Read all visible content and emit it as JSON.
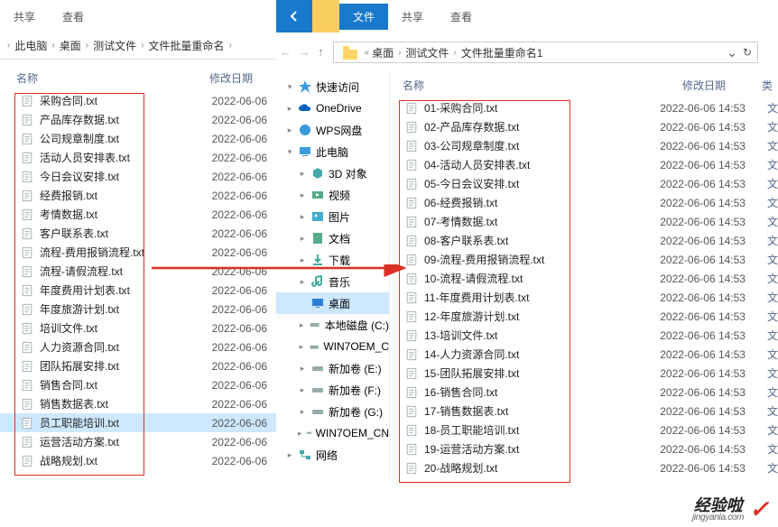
{
  "left": {
    "tabs": {
      "share": "共享",
      "view": "查看"
    },
    "breadcrumb": [
      "此电脑",
      "桌面",
      "测试文件",
      "文件批量重命名"
    ],
    "cols": {
      "name": "名称",
      "date": "修改日期"
    },
    "files": [
      {
        "name": "采购合同.txt",
        "date": "2022-06-06"
      },
      {
        "name": "产品库存数据.txt",
        "date": "2022-06-06"
      },
      {
        "name": "公司规章制度.txt",
        "date": "2022-06-06"
      },
      {
        "name": "活动人员安排表.txt",
        "date": "2022-06-06"
      },
      {
        "name": "今日会议安排.txt",
        "date": "2022-06-06"
      },
      {
        "name": "经费报销.txt",
        "date": "2022-06-06"
      },
      {
        "name": "考情数据.txt",
        "date": "2022-06-06"
      },
      {
        "name": "客户联系表.txt",
        "date": "2022-06-06"
      },
      {
        "name": "流程-费用报销流程.txt",
        "date": "2022-06-06"
      },
      {
        "name": "流程-请假流程.txt",
        "date": "2022-06-06"
      },
      {
        "name": "年度费用计划表.txt",
        "date": "2022-06-06"
      },
      {
        "name": "年度旅游计划.txt",
        "date": "2022-06-06"
      },
      {
        "name": "培训文件.txt",
        "date": "2022-06-06"
      },
      {
        "name": "人力资源合同.txt",
        "date": "2022-06-06"
      },
      {
        "name": "团队拓展安排.txt",
        "date": "2022-06-06"
      },
      {
        "name": "销售合同.txt",
        "date": "2022-06-06"
      },
      {
        "name": "销售数据表.txt",
        "date": "2022-06-06"
      },
      {
        "name": "员工职能培训.txt",
        "date": "2022-06-06",
        "selected": true
      },
      {
        "name": "运营活动方案.txt",
        "date": "2022-06-06"
      },
      {
        "name": "战略规划.txt",
        "date": "2022-06-06"
      }
    ]
  },
  "right": {
    "tabs": {
      "file": "文件",
      "share": "共享",
      "view": "查看"
    },
    "breadcrumb": [
      "桌面",
      "测试文件",
      "文件批量重命名1"
    ],
    "cols": {
      "name": "名称",
      "date": "修改日期",
      "type": "类"
    },
    "tree": [
      {
        "icon": "star",
        "label": "快速访问",
        "lvl": 1,
        "exp": "▾"
      },
      {
        "icon": "cloud",
        "label": "OneDrive",
        "lvl": 1,
        "exp": "▸"
      },
      {
        "icon": "wps",
        "label": "WPS网盘",
        "lvl": 1,
        "exp": "▸"
      },
      {
        "icon": "pc",
        "label": "此电脑",
        "lvl": 1,
        "exp": "▾"
      },
      {
        "icon": "3d",
        "label": "3D 对象",
        "lvl": 2,
        "exp": "▸"
      },
      {
        "icon": "video",
        "label": "视频",
        "lvl": 2,
        "exp": "▸"
      },
      {
        "icon": "pic",
        "label": "图片",
        "lvl": 2,
        "exp": "▸"
      },
      {
        "icon": "doc",
        "label": "文档",
        "lvl": 2,
        "exp": "▸"
      },
      {
        "icon": "dl",
        "label": "下载",
        "lvl": 2,
        "exp": "▸"
      },
      {
        "icon": "music",
        "label": "音乐",
        "lvl": 2,
        "exp": "▸"
      },
      {
        "icon": "desktop",
        "label": "桌面",
        "lvl": 2,
        "exp": "",
        "active": true
      },
      {
        "icon": "disk",
        "label": "本地磁盘 (C:)",
        "lvl": 2,
        "exp": "▸"
      },
      {
        "icon": "disk",
        "label": "WIN7OEM_C",
        "lvl": 2,
        "exp": "▸"
      },
      {
        "icon": "disk",
        "label": "新加卷 (E:)",
        "lvl": 2,
        "exp": "▸"
      },
      {
        "icon": "disk",
        "label": "新加卷 (F:)",
        "lvl": 2,
        "exp": "▸"
      },
      {
        "icon": "disk",
        "label": "新加卷 (G:)",
        "lvl": 2,
        "exp": "▸"
      },
      {
        "icon": "disk",
        "label": "WIN7OEM_CN",
        "lvl": 2,
        "exp": "▸"
      },
      {
        "icon": "net",
        "label": "网络",
        "lvl": 1,
        "exp": "▸"
      }
    ],
    "files": [
      {
        "name": "01-采购合同.txt",
        "date": "2022-06-06 14:53",
        "type": "文"
      },
      {
        "name": "02-产品库存数据.txt",
        "date": "2022-06-06 14:53",
        "type": "文"
      },
      {
        "name": "03-公司规章制度.txt",
        "date": "2022-06-06 14:53",
        "type": "文"
      },
      {
        "name": "04-活动人员安排表.txt",
        "date": "2022-06-06 14:53",
        "type": "文"
      },
      {
        "name": "05-今日会议安排.txt",
        "date": "2022-06-06 14:53",
        "type": "文"
      },
      {
        "name": "06-经费报销.txt",
        "date": "2022-06-06 14:53",
        "type": "文"
      },
      {
        "name": "07-考情数据.txt",
        "date": "2022-06-06 14:53",
        "type": "文"
      },
      {
        "name": "08-客户联系表.txt",
        "date": "2022-06-06 14:53",
        "type": "文"
      },
      {
        "name": "09-流程-费用报销流程.txt",
        "date": "2022-06-06 14:53",
        "type": "文"
      },
      {
        "name": "10-流程-请假流程.txt",
        "date": "2022-06-06 14:53",
        "type": "文"
      },
      {
        "name": "11-年度费用计划表.txt",
        "date": "2022-06-06 14:53",
        "type": "文"
      },
      {
        "name": "12-年度旅游计划.txt",
        "date": "2022-06-06 14:53",
        "type": "文"
      },
      {
        "name": "13-培训文件.txt",
        "date": "2022-06-06 14:53",
        "type": "文"
      },
      {
        "name": "14-人力资源合同.txt",
        "date": "2022-06-06 14:53",
        "type": "文"
      },
      {
        "name": "15-团队拓展安排.txt",
        "date": "2022-06-06 14:53",
        "type": "文"
      },
      {
        "name": "16-销售合同.txt",
        "date": "2022-06-06 14:53",
        "type": "文"
      },
      {
        "name": "17-销售数据表.txt",
        "date": "2022-06-06 14:53",
        "type": "文"
      },
      {
        "name": "18-员工职能培训.txt",
        "date": "2022-06-06 14:53",
        "type": "文"
      },
      {
        "name": "19-运营活动方案.txt",
        "date": "2022-06-06 14:53",
        "type": "文"
      },
      {
        "name": "20-战略规划.txt",
        "date": "2022-06-06 14:53",
        "type": "文"
      }
    ]
  },
  "watermark": {
    "cn": "经验啦",
    "en": "jingyanla.com"
  }
}
